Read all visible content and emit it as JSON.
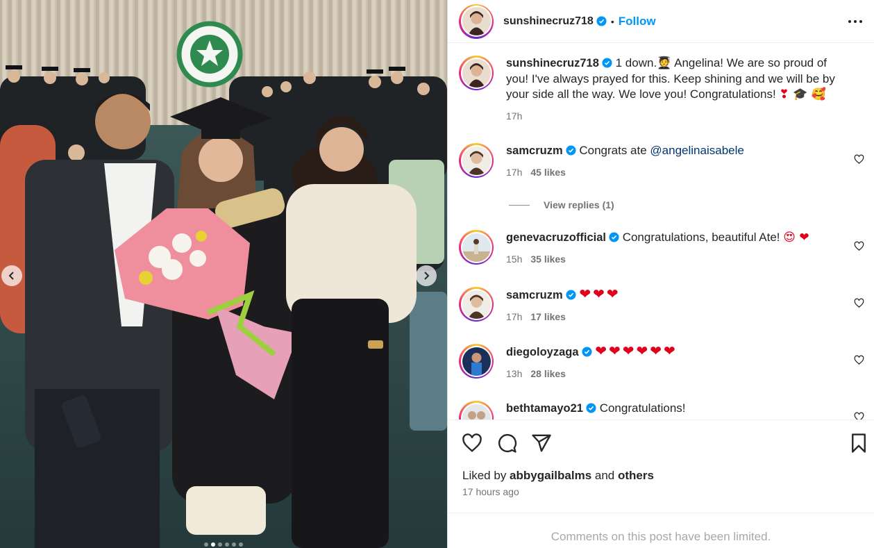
{
  "post": {
    "media": {
      "current_slide": 2,
      "slide_count": 6
    },
    "header": {
      "username": "sunshinecruz718",
      "separator": "•",
      "follow_label": "Follow"
    },
    "caption": {
      "username": "sunshinecruz718",
      "text_before_emoji": "1 down.",
      "text_after_emoji": " Angelina! We are so proud of you! I've always prayed for this. Keep shining and we will be by your side all the way. We love you! Congratulations!",
      "trailing_emojis": "❣ 🎓 🥰",
      "time": "17h"
    },
    "comments": [
      {
        "username": "samcruzm",
        "text": "Congrats ate ",
        "mention": "@angelinaisabele",
        "time": "17h",
        "likes": "45 likes"
      },
      {
        "username": "genevacruzofficial",
        "text": "Congratulations, beautiful Ate! ",
        "emojis": "😍 ❤",
        "time": "15h",
        "likes": "35 likes"
      },
      {
        "username": "samcruzm",
        "text": "",
        "emojis": "❤❤❤",
        "time": "17h",
        "likes": "17 likes"
      },
      {
        "username": "diegoloyzaga",
        "text": "",
        "emojis": "❤❤❤❤❤❤",
        "time": "13h",
        "likes": "28 likes"
      },
      {
        "username": "bethtamayo21",
        "text": "Congratulations!",
        "time": "",
        "likes": ""
      }
    ],
    "view_replies_label": "View replies (1)",
    "liked_by": {
      "prefix": "Liked by ",
      "user": "abbygailbalms",
      "middle": " and ",
      "others": "others"
    },
    "posted_ago": "17 hours ago",
    "comments_limited": "Comments on this post have been limited.",
    "colors": {
      "accent": "#0095f6",
      "verified": "#0095f6",
      "heart_red": "#e0001b",
      "muted": "#737373"
    }
  }
}
